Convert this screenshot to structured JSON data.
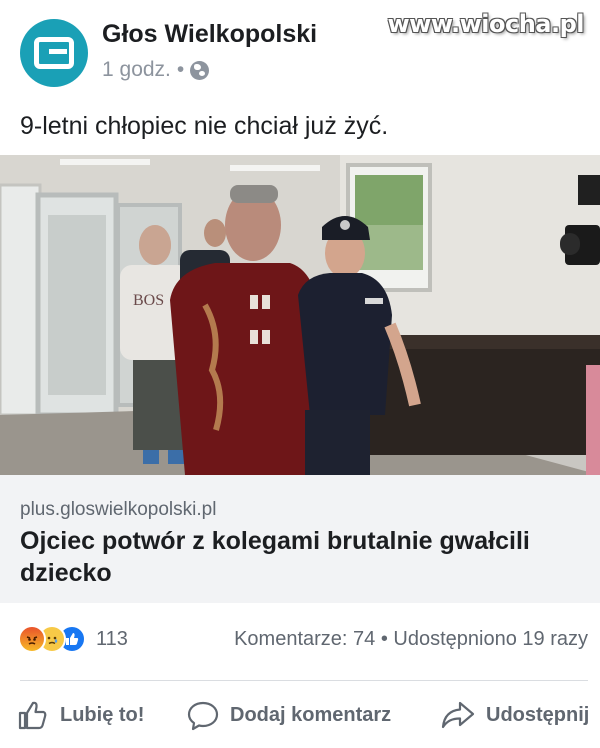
{
  "page": {
    "name": "Głos Wielkopolski",
    "time": "1 godz.",
    "separator": "•",
    "avatar_icon": "gw-logo-icon",
    "privacy_icon": "globe-icon"
  },
  "watermark": "www.wiocha.pl",
  "post": {
    "text": "9-letni chłopiec nie chciał już żyć."
  },
  "link": {
    "domain": "plus.gloswielkopolski.pl",
    "title": "Ojciec potwór z kolegami brutalnie gwałcili dziecko"
  },
  "stats": {
    "reaction_icons": [
      "angry-icon",
      "sad-icon",
      "like-icon"
    ],
    "reaction_count": "113",
    "comments": "Komentarze: 74",
    "separator": "•",
    "shares": "Udostępniono 19 razy"
  },
  "actions": {
    "like": "Lubię to!",
    "comment": "Dodaj komentarz",
    "share": "Udostępnij"
  },
  "colors": {
    "accent": "#1877f2",
    "logo": "#1aa0b6",
    "muted": "#606770"
  }
}
